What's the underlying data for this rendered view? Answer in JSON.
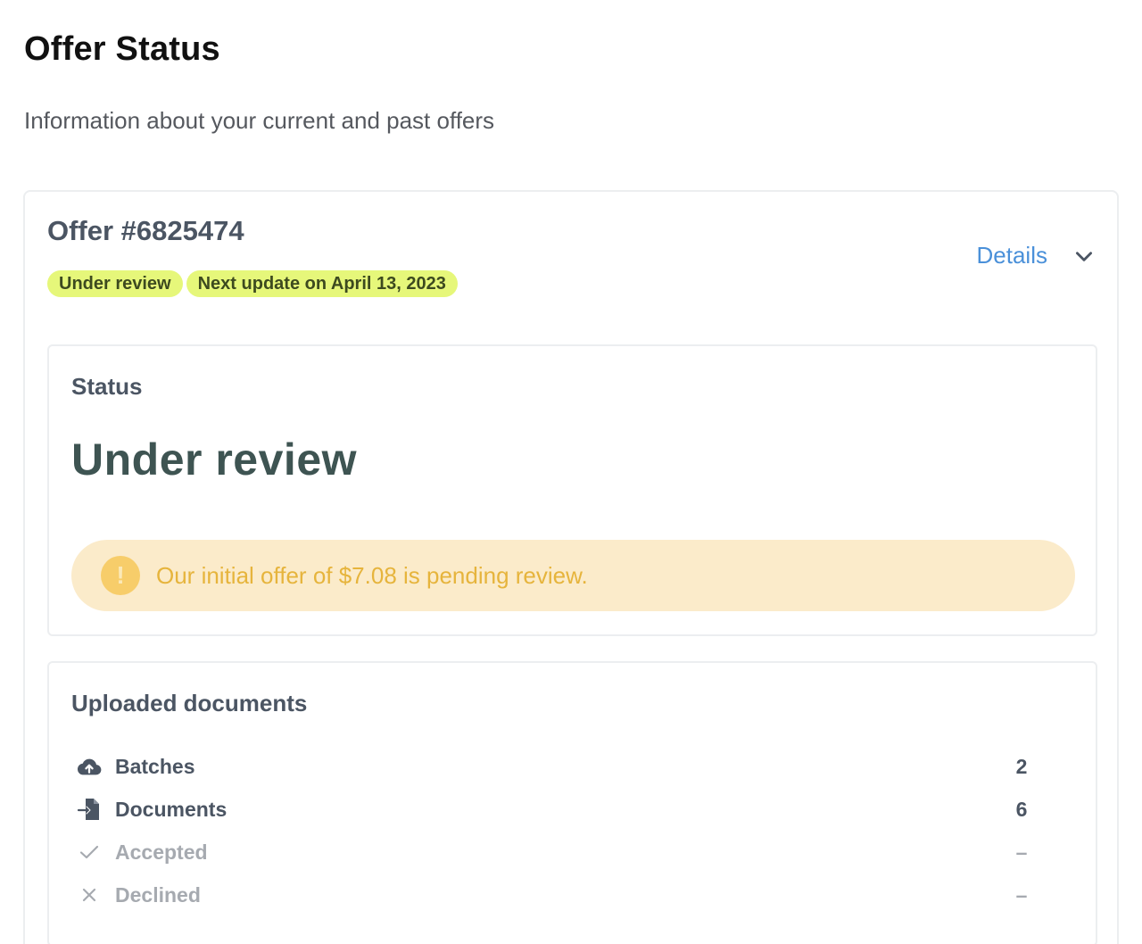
{
  "header": {
    "title": "Offer Status",
    "subtitle": "Information about your current and past offers"
  },
  "offer": {
    "title": "Offer #6825474",
    "badges": [
      "Under review",
      "Next update on April 13, 2023"
    ],
    "details_label": "Details",
    "badge_color": "#e6f77a",
    "link_color": "#4a90d9"
  },
  "status_panel": {
    "heading": "Status",
    "status": "Under review",
    "alert": {
      "icon": "!",
      "text": "Our initial offer of $7.08 is pending review.",
      "background": "#fbebca",
      "text_color": "#e6b43c"
    }
  },
  "documents_panel": {
    "heading": "Uploaded documents",
    "rows": [
      {
        "label": "Batches",
        "value": "2",
        "icon": "cloud-upload-icon"
      },
      {
        "label": "Documents",
        "value": "6",
        "icon": "document-import-icon"
      },
      {
        "label": "Accepted",
        "value": "–",
        "icon": "check-icon"
      },
      {
        "label": "Declined",
        "value": "–",
        "icon": "x-icon"
      }
    ]
  }
}
